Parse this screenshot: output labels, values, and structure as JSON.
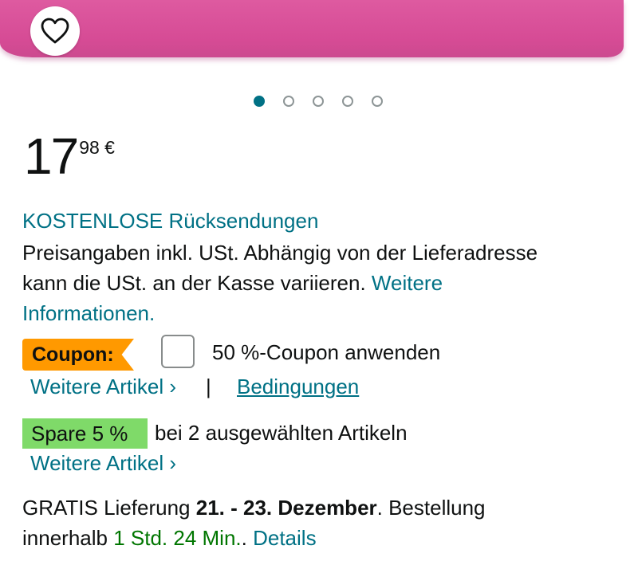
{
  "price": {
    "whole": "17",
    "fraction": "98 €"
  },
  "carousel": {
    "count": 5,
    "active_index": 0
  },
  "returns": {
    "label": "KOSTENLOSE Rücksendungen"
  },
  "tax_note": {
    "line1": "Preisangaben inkl. USt. Abhängig von der Lieferadresse",
    "line2": "kann die USt. an der Kasse variieren.",
    "link_part1": "Weitere",
    "link_part2": "Informationen."
  },
  "coupon": {
    "badge": "Coupon:",
    "apply_label": "50 %-Coupon anwenden",
    "more_items": "Weitere Artikel ›",
    "separator": "|",
    "terms": "Bedingungen"
  },
  "savings": {
    "badge": "Spare 5 %",
    "text": "bei 2 ausgewählten Artikeln",
    "more_items": "Weitere Artikel ›"
  },
  "delivery": {
    "prefix": "GRATIS Lieferung",
    "dates": "21. - 23. Dezember",
    "suffix": ". Bestellung",
    "line2_prefix": "innerhalb",
    "countdown": "1 Std. 24 Min.",
    "line2_dot": ". ",
    "details": "Details"
  },
  "colors": {
    "link": "#007185",
    "coupon": "#ff9900",
    "save": "#7fda69",
    "countdown": "#007600",
    "image": "#d64b95"
  },
  "icons": {
    "favorite": "heart-outline-icon"
  }
}
